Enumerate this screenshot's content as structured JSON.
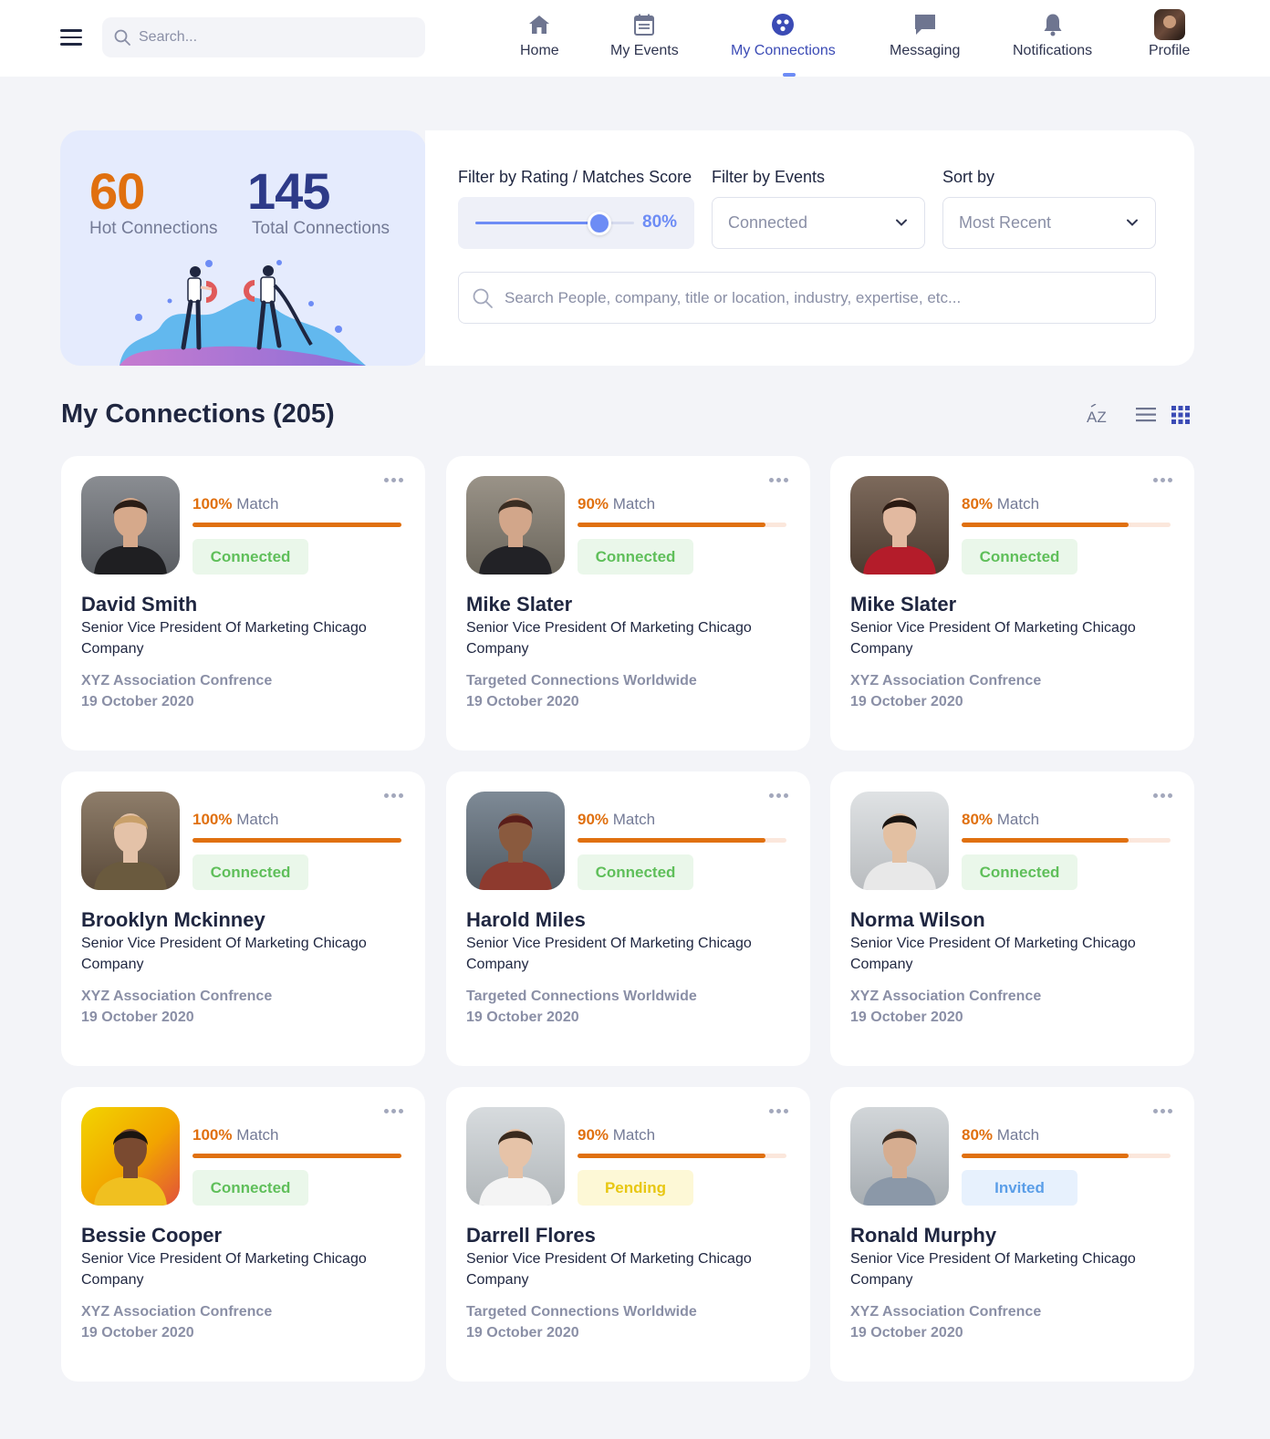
{
  "header": {
    "search_placeholder": "Search...",
    "nav": [
      {
        "label": "Home",
        "icon": "home-icon"
      },
      {
        "label": "My Events",
        "icon": "calendar-icon"
      },
      {
        "label": "My Connections",
        "icon": "connections-icon",
        "active": true
      },
      {
        "label": "Messaging",
        "icon": "chat-icon"
      },
      {
        "label": "Notifications",
        "icon": "bell-icon"
      },
      {
        "label": "Profile",
        "icon": "avatar"
      }
    ]
  },
  "summary": {
    "hot_count": "60",
    "hot_label": "Hot Connections",
    "total_count": "145",
    "total_label": "Total Connections"
  },
  "filters": {
    "rating_label": "Filter by Rating / Matches Score",
    "rating_value": "80%",
    "rating_level": 0.8,
    "events_label": "Filter by Events",
    "events_selected": "Connected",
    "sort_label": "Sort by",
    "sort_selected": "Most Recent",
    "people_search_placeholder": "Search People, company, title or location, industry, expertise, etc..."
  },
  "section": {
    "title": "My Connections (205)",
    "sort_az_icon": "AZ"
  },
  "colors": {
    "accent": "#6d8cf5",
    "hot": "#e0700f",
    "total": "#2d3a88",
    "connected": "#5fbf5a",
    "pending": "#e8c712",
    "invited": "#5a9ee8"
  },
  "cards": [
    {
      "name": "David Smith",
      "match_pct": "100%",
      "match_word": "Match",
      "match_level": 1.0,
      "status": "Connected",
      "status_type": "connected",
      "title": "Senior Vice President Of Marketing Chicago Company",
      "event": "XYZ Association Confrence",
      "date": "19 October 2020"
    },
    {
      "name": "Mike Slater",
      "match_pct": "90%",
      "match_word": "Match",
      "match_level": 0.9,
      "status": "Connected",
      "status_type": "connected",
      "title": "Senior Vice President Of Marketing Chicago Company",
      "event": "Targeted Connections Worldwide",
      "date": "19 October 2020"
    },
    {
      "name": "Mike Slater",
      "match_pct": "80%",
      "match_word": "Match",
      "match_level": 0.8,
      "status": "Connected",
      "status_type": "connected",
      "title": "Senior Vice President Of Marketing Chicago Company",
      "event": "XYZ Association Confrence",
      "date": "19 October 2020"
    },
    {
      "name": "Brooklyn Mckinney",
      "match_pct": "100%",
      "match_word": "Match",
      "match_level": 1.0,
      "status": "Connected",
      "status_type": "connected",
      "title": "Senior Vice President Of Marketing Chicago Company",
      "event": "XYZ Association Confrence",
      "date": "19 October 2020"
    },
    {
      "name": "Harold Miles",
      "match_pct": "90%",
      "match_word": "Match",
      "match_level": 0.9,
      "status": "Connected",
      "status_type": "connected",
      "title": "Senior Vice President Of Marketing Chicago Company",
      "event": "Targeted Connections Worldwide",
      "date": "19 October 2020"
    },
    {
      "name": "Norma Wilson",
      "match_pct": "80%",
      "match_word": "Match",
      "match_level": 0.8,
      "status": "Connected",
      "status_type": "connected",
      "title": "Senior Vice President Of Marketing Chicago Company",
      "event": "XYZ Association Confrence",
      "date": "19 October 2020"
    },
    {
      "name": "Bessie Cooper",
      "match_pct": "100%",
      "match_word": "Match",
      "match_level": 1.0,
      "status": "Connected",
      "status_type": "connected",
      "title": "Senior Vice President Of Marketing Chicago Company",
      "event": "XYZ Association Confrence",
      "date": "19 October 2020"
    },
    {
      "name": "Darrell Flores",
      "match_pct": "90%",
      "match_word": "Match",
      "match_level": 0.9,
      "status": "Pending",
      "status_type": "pending",
      "title": "Senior Vice President Of Marketing Chicago Company",
      "event": "Targeted Connections Worldwide",
      "date": "19 October 2020"
    },
    {
      "name": "Ronald Murphy",
      "match_pct": "80%",
      "match_word": "Match",
      "match_level": 0.8,
      "status": "Invited",
      "status_type": "invited",
      "title": "Senior Vice President Of Marketing Chicago Company",
      "event": "XYZ Association Confrence",
      "date": "19 October 2020"
    }
  ]
}
